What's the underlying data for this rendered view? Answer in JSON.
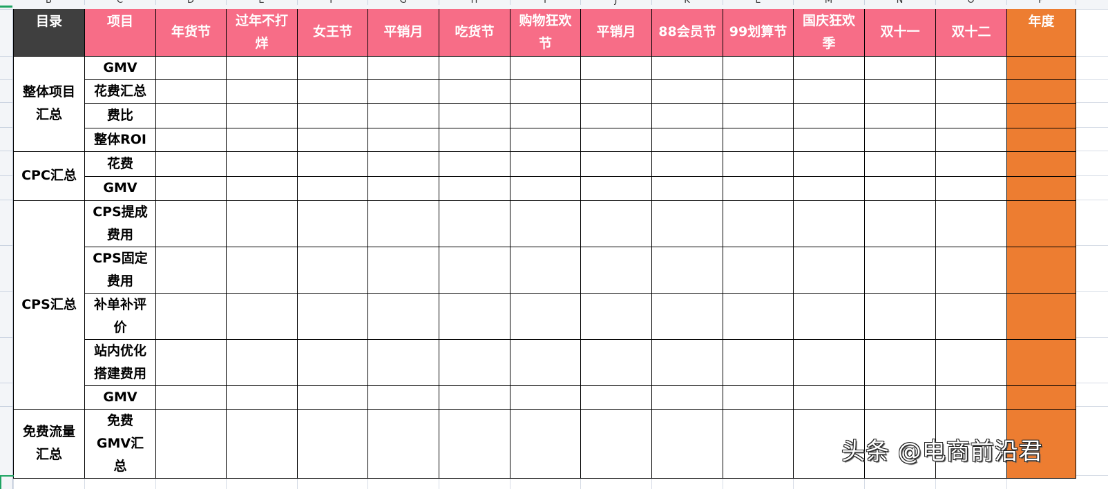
{
  "spreadsheet": {
    "column_letters": [
      "B",
      "C",
      "D",
      "E",
      "F",
      "G",
      "H",
      "I",
      "J",
      "K",
      "L",
      "M",
      "N",
      "O",
      "P"
    ],
    "header_row": {
      "catalog": "目录",
      "item": "项目",
      "periods": [
        "年货节",
        "过年不打烊",
        "女王节",
        "平销月",
        "吃货节",
        "购物狂欢节",
        "平销月",
        "88会员节",
        "99划算节",
        "国庆狂欢季",
        "双十一",
        "双十二"
      ],
      "annual": "年度"
    },
    "groups": [
      {
        "label": "整体项目汇总",
        "items": [
          "GMV",
          "花费汇总",
          "费比",
          "整体ROI"
        ]
      },
      {
        "label": "CPC汇总",
        "items": [
          "花费",
          "GMV"
        ]
      },
      {
        "label": "CPS汇总",
        "items": [
          "CPS提成费用",
          "CPS固定费用",
          "补单补评价",
          "站内优化搭建费用",
          "GMV"
        ]
      },
      {
        "label": "免费流量汇总",
        "items": [
          "免费GMV汇总"
        ]
      }
    ],
    "colors": {
      "header_pink": "#f76d87",
      "header_dark": "#3f3f3f",
      "annual_orange": "#ed7d31",
      "selection_green": "#1fa463"
    }
  },
  "watermark": "头条 @电商前沿君"
}
